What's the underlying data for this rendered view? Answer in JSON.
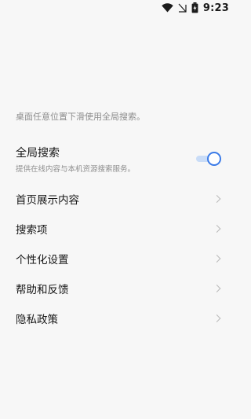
{
  "status_bar": {
    "time": "9:23",
    "icons": [
      "wifi-icon",
      "sim-icon",
      "battery-icon"
    ]
  },
  "hint": "桌面任意位置下滑使用全局搜索。",
  "global_search": {
    "title": "全局搜索",
    "description": "提供在线内容与本机资源搜索服务。",
    "toggle_on": true
  },
  "menu": {
    "items": [
      {
        "label": "首页展示内容"
      },
      {
        "label": "搜索项"
      },
      {
        "label": "个性化设置"
      },
      {
        "label": "帮助和反馈"
      },
      {
        "label": "隐私政策"
      }
    ]
  },
  "colors": {
    "accent": "#3b7be8",
    "background": "#f7f7f7",
    "hint": "#8d8d8d"
  }
}
